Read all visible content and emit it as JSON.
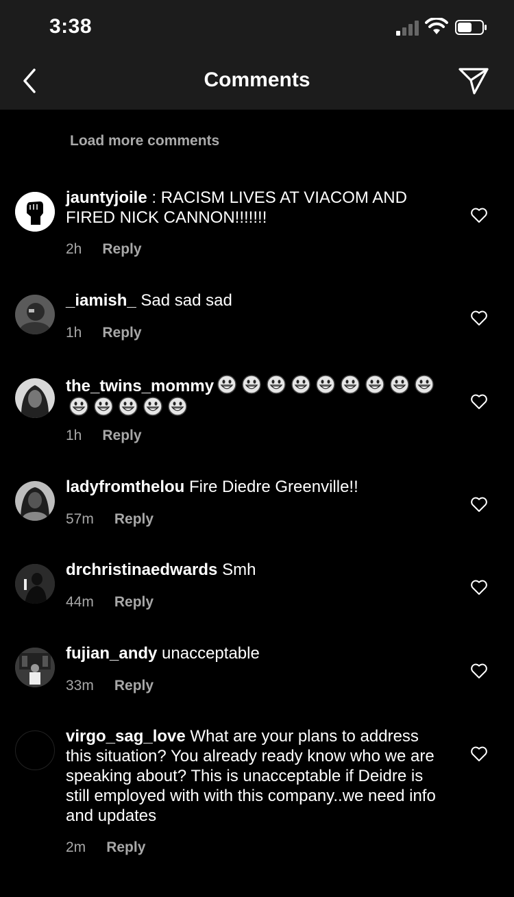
{
  "status_bar": {
    "time": "3:38"
  },
  "header": {
    "title": "Comments"
  },
  "load_more": "Load more comments",
  "comments": [
    {
      "username": "jauntyjoile",
      "text": " : RACISM LIVES AT VIACOM AND FIRED NICK CANNON!!!!!!!",
      "time": "2h",
      "reply": "Reply"
    },
    {
      "username": "_iamish_",
      "text": "Sad sad sad",
      "time": "1h",
      "reply": "Reply"
    },
    {
      "username": "the_twins_mommy",
      "text": "",
      "emoji_count": 14,
      "emoji_name": "grinning-face-emoji",
      "time": "1h",
      "reply": "Reply"
    },
    {
      "username": "ladyfromthelou",
      "text": "Fire Diedre Greenville!!",
      "time": "57m",
      "reply": "Reply"
    },
    {
      "username": "drchristinaedwards",
      "text": "Smh",
      "time": "44m",
      "reply": "Reply"
    },
    {
      "username": "fujian_andy",
      "text": "unacceptable",
      "time": "33m",
      "reply": "Reply"
    },
    {
      "username": "virgo_sag_love",
      "text": "What are your plans to address this situation? You already ready know who we are speaking about? This is unacceptable if Deidre is still  employed with with this company..we need info and updates",
      "time": "2m",
      "reply": "Reply"
    }
  ],
  "icons": {
    "back": "chevron-left-icon",
    "send": "paper-plane-icon",
    "like": "heart-outline-icon"
  },
  "colors": {
    "background": "#000000",
    "bar": "#1c1c1c",
    "secondary_text": "#a8a8a8"
  }
}
